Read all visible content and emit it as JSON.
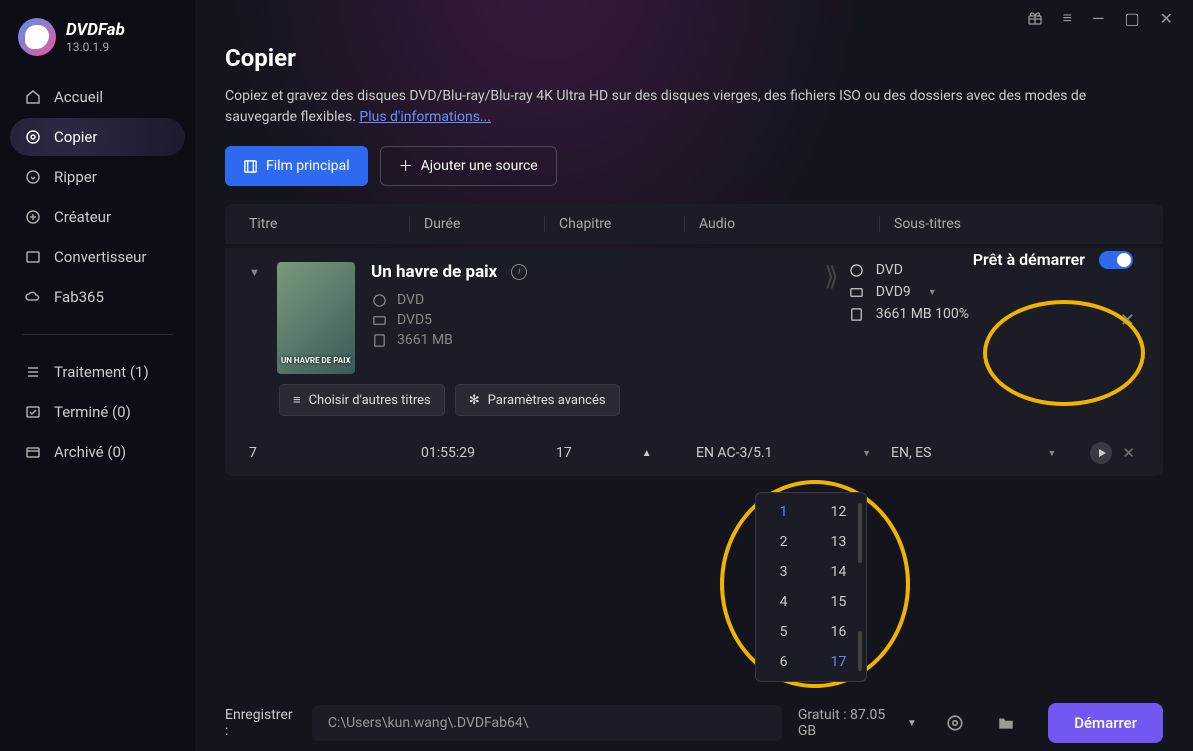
{
  "brand": {
    "name": "DVDFab",
    "version": "13.0.1.9"
  },
  "sidebar": {
    "items": [
      {
        "label": "Accueil"
      },
      {
        "label": "Copier"
      },
      {
        "label": "Ripper"
      },
      {
        "label": "Créateur"
      },
      {
        "label": "Convertisseur"
      },
      {
        "label": "Fab365"
      }
    ],
    "queue": [
      {
        "label": "Traitement (1)"
      },
      {
        "label": "Terminé (0)"
      },
      {
        "label": "Archivé (0)"
      }
    ]
  },
  "page": {
    "title": "Copier",
    "desc": "Copiez et gravez des disques DVD/Blu-ray/Blu-ray 4K Ultra HD sur des disques vierges, des fichiers ISO ou des dossiers avec des modes de sauvegarde flexibles. ",
    "more": "Plus d'informations..."
  },
  "actions": {
    "main_movie": "Film principal",
    "add_source": "Ajouter une source"
  },
  "table": {
    "headers": {
      "title": "Titre",
      "duration": "Durée",
      "chapter": "Chapitre",
      "audio": "Audio",
      "subs": "Sous-titres"
    }
  },
  "movie": {
    "title": "Un havre de paix",
    "poster_text": "UN HAVRE DE PAIX",
    "source_type": "DVD",
    "source_disc": "DVD5",
    "source_size": "3661 MB",
    "out_type": "DVD",
    "out_disc": "DVD9",
    "out_size": "3661 MB 100%",
    "status": "Prêt à démarrer",
    "choose_other": "Choisir d'autres titres",
    "adv_params": "Paramètres avancés"
  },
  "detail": {
    "num": "7",
    "duration": "01:55:29",
    "chapter": "17",
    "audio": "EN  AC-3/5.1",
    "subs": "EN, ES"
  },
  "chapter_dropdown": {
    "col1": [
      "1",
      "2",
      "3",
      "4",
      "5",
      "6"
    ],
    "col2": [
      "12",
      "13",
      "14",
      "15",
      "16",
      "17"
    ],
    "selected_start": "1",
    "selected_end": "17"
  },
  "footer": {
    "save_label": "Enregistrer :",
    "path": "C:\\Users\\kun.wang\\.DVDFab64\\",
    "free": "Gratuit : 87.05 GB",
    "start": "Démarrer"
  }
}
